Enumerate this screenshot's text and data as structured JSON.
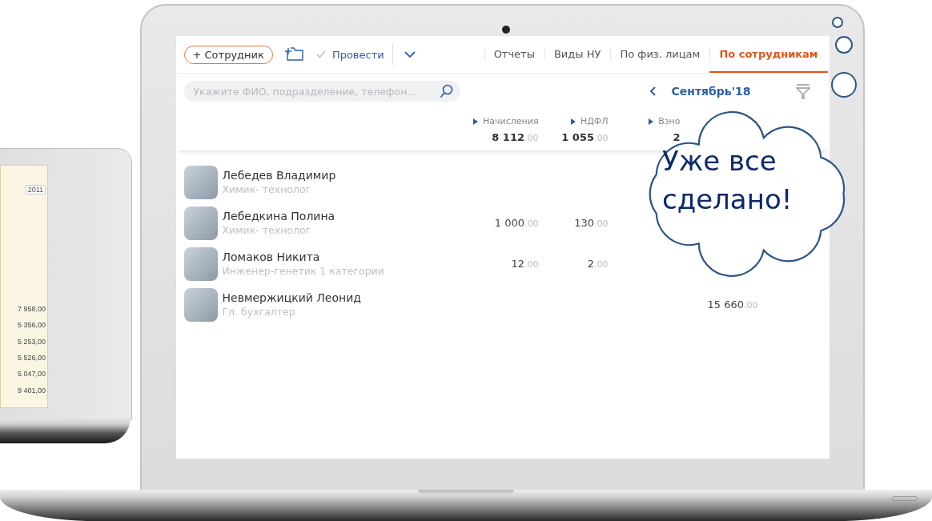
{
  "toolbar": {
    "add_button": "+ Сотрудник",
    "post_button": "Провести",
    "tabs": [
      {
        "label": "Отчеты",
        "selected": false
      },
      {
        "label": "Виды НУ",
        "selected": false
      },
      {
        "label": "По физ. лицам",
        "selected": false
      },
      {
        "label": "По сотрудникам",
        "selected": true
      }
    ]
  },
  "search": {
    "placeholder": "Укажите ФИО, подразделение, телефон..."
  },
  "period": "Сентябрь'18",
  "summary": [
    {
      "label": "Начисления",
      "total": "8 112.00"
    },
    {
      "label": "НДФЛ",
      "total": "1 055.00"
    },
    {
      "label": "Взно",
      "total": "2"
    }
  ],
  "employees": [
    {
      "name": "Лебедев Владимир",
      "position": "Химик- технолог"
    },
    {
      "name": "Лебедкина Полина",
      "position": "Химик- технолог",
      "amounts": {
        "column_1": "1 000.00",
        "column_2": "130.00"
      }
    },
    {
      "name": "Ломаков Никита",
      "position": "Инженер-генетик 1 категории",
      "amounts": {
        "column_1": "12.00",
        "column_2": "2.00"
      }
    },
    {
      "name": "Невмержицкий Леонид",
      "position": "Гл. бухгалтер",
      "amounts": {
        "column_4": "15 660.00"
      }
    }
  ],
  "bubble": {
    "text": "Уже все сделано!"
  },
  "left_laptop": {
    "year": "2011",
    "amounts": [
      "7 958,00",
      "5 356,00",
      "5 253,00",
      "5 526,00",
      "5 047,00",
      "9 401,00"
    ]
  }
}
